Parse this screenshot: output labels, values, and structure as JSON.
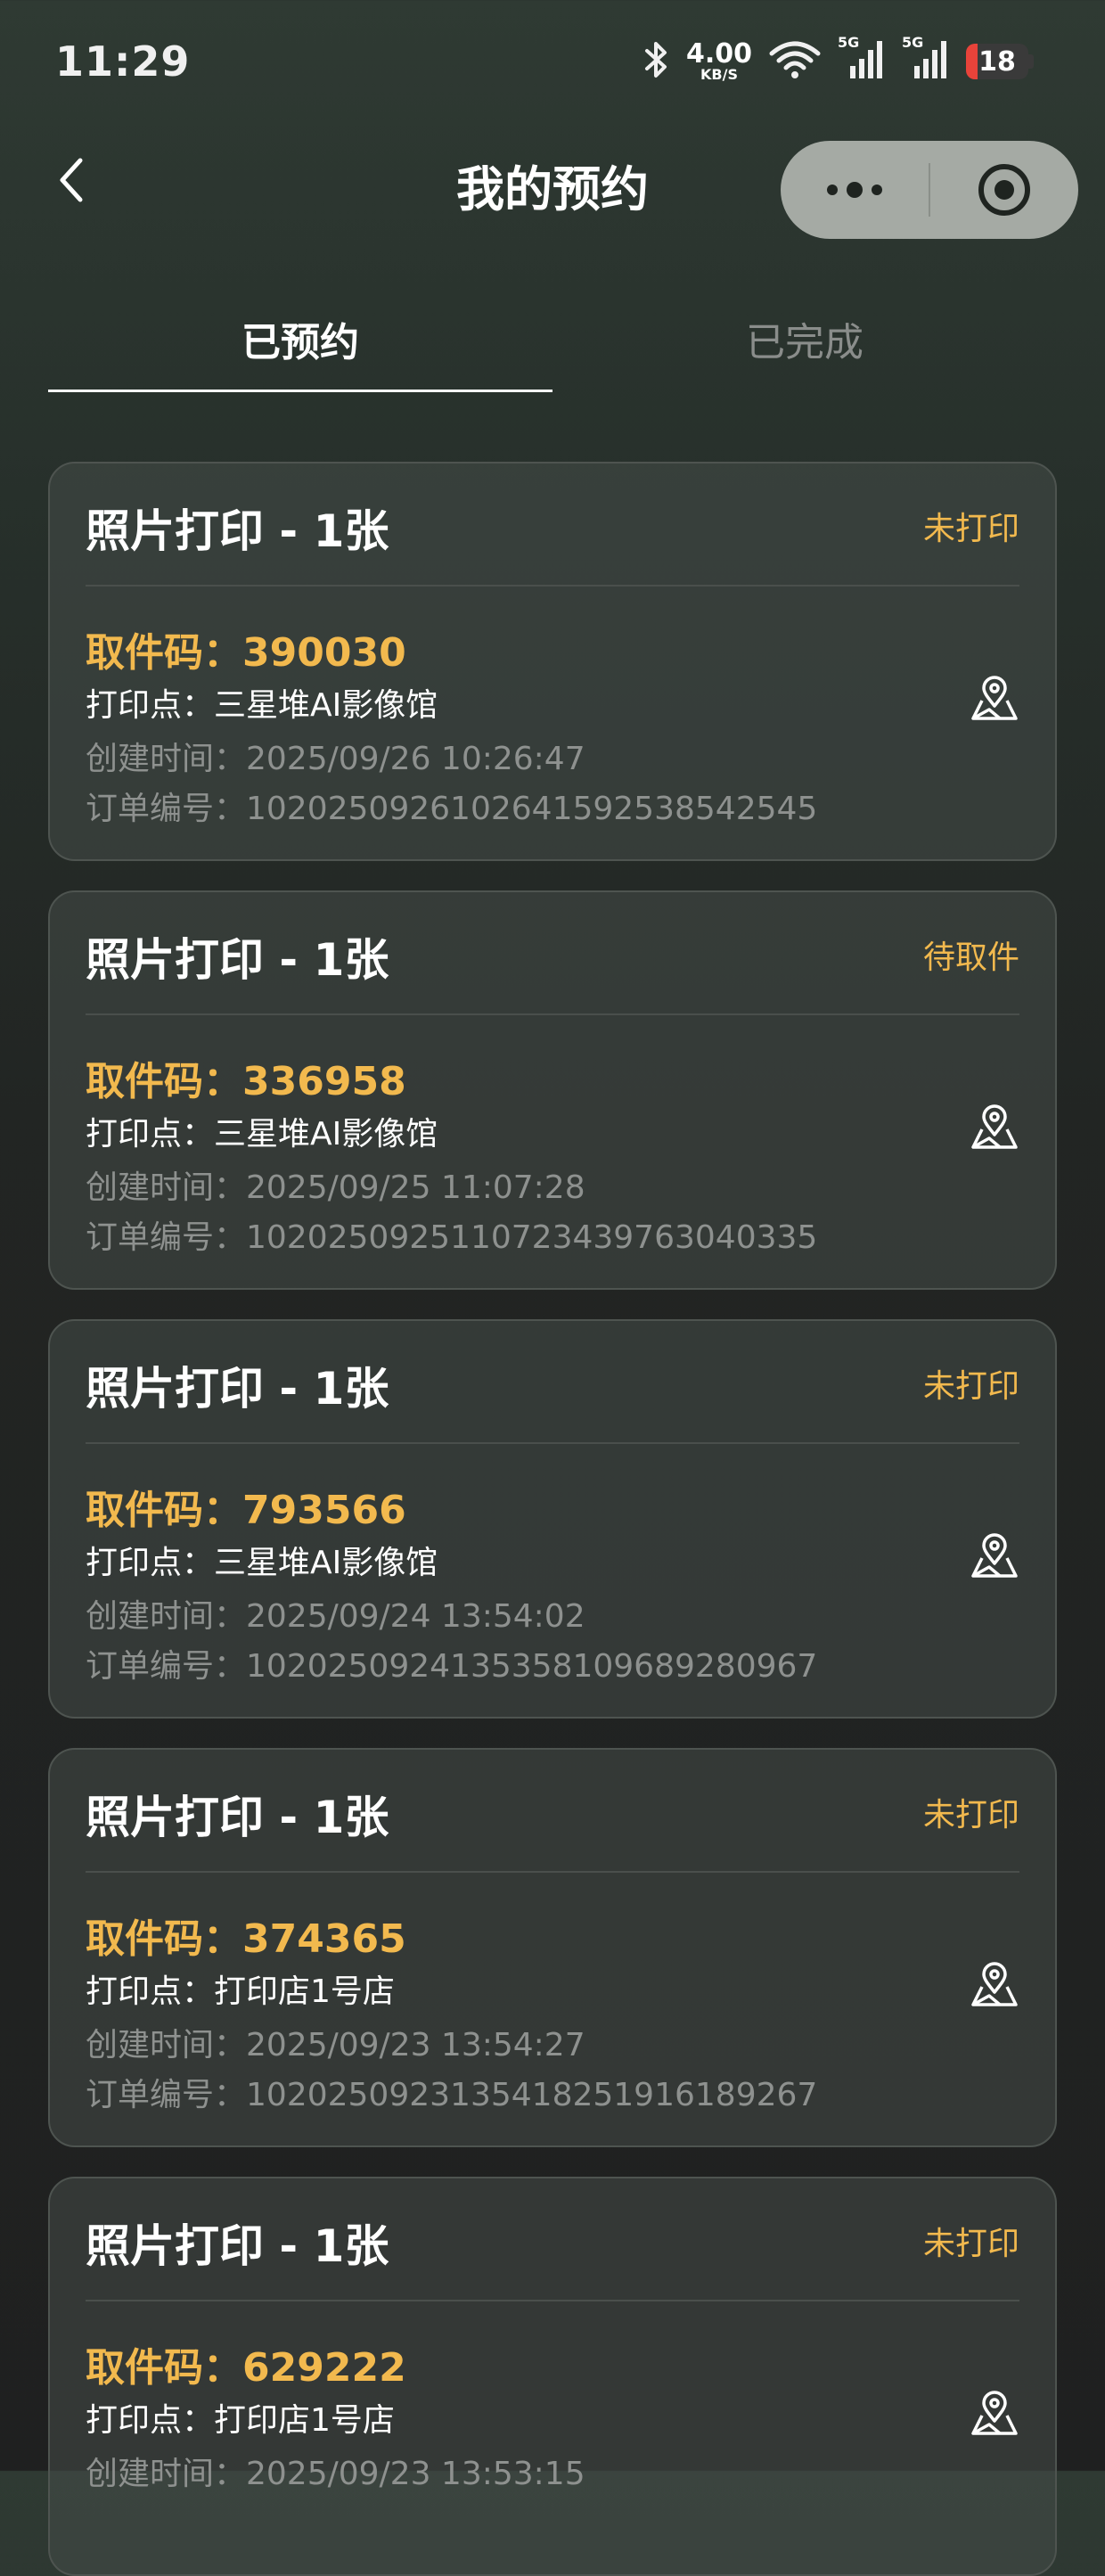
{
  "status_bar": {
    "time": "11:29",
    "net_speed_value": "4.00",
    "net_speed_unit": "KB/S",
    "signal_1_label": "5G",
    "signal_2_label": "5G",
    "battery_level": "18",
    "battery_fraction": 0.18,
    "icons": [
      "bluetooth-icon",
      "wifi-icon",
      "signal-icon",
      "signal-icon",
      "battery-icon"
    ]
  },
  "nav": {
    "title": "我的预约",
    "back_icon": "chevron-left-icon",
    "more_icon": "more-dots-icon",
    "close_icon": "target-circle-icon"
  },
  "tabs": [
    {
      "label": "已预约",
      "active": true
    },
    {
      "label": "已完成",
      "active": false
    }
  ],
  "colors": {
    "accent": "#f2b94e",
    "muted_text": "#8e918f",
    "card_border": "#4e5450"
  },
  "orders": [
    {
      "title": "照片打印 - 1张",
      "status": "未打印",
      "code": "取件码：390030",
      "location": "打印点：三星堆AI影像馆",
      "created": "创建时间：2025/09/26 10:26:47",
      "order_no": "订单编号：102025092610264159253854254​5"
    },
    {
      "title": "照片打印 - 1张",
      "status": "待取件",
      "code": "取件码：336958",
      "location": "打印点：三星堆AI影像馆",
      "created": "创建时间：2025/09/25 11:07:28",
      "order_no": "订单编号：102025092511072343976304033​5"
    },
    {
      "title": "照片打印 - 1张",
      "status": "未打印",
      "code": "取件码：793566",
      "location": "打印点：三星堆AI影像馆",
      "created": "创建时间：2025/09/24 13:54:02",
      "order_no": "订单编号：102025092413535810968928096​7"
    },
    {
      "title": "照片打印 - 1张",
      "status": "未打印",
      "code": "取件码：374365",
      "location": "打印点：打印店1号店",
      "created": "创建时间：2025/09/23 13:54:27",
      "order_no": "订单编号：102025092313541825191618926​7"
    },
    {
      "title": "照片打印 - 1张",
      "status": "未打印",
      "code": "取件码：629222",
      "location": "打印点：打印店1号店",
      "created": "创建时间：2025/09/23 13:53:15",
      "order_no": ""
    }
  ]
}
